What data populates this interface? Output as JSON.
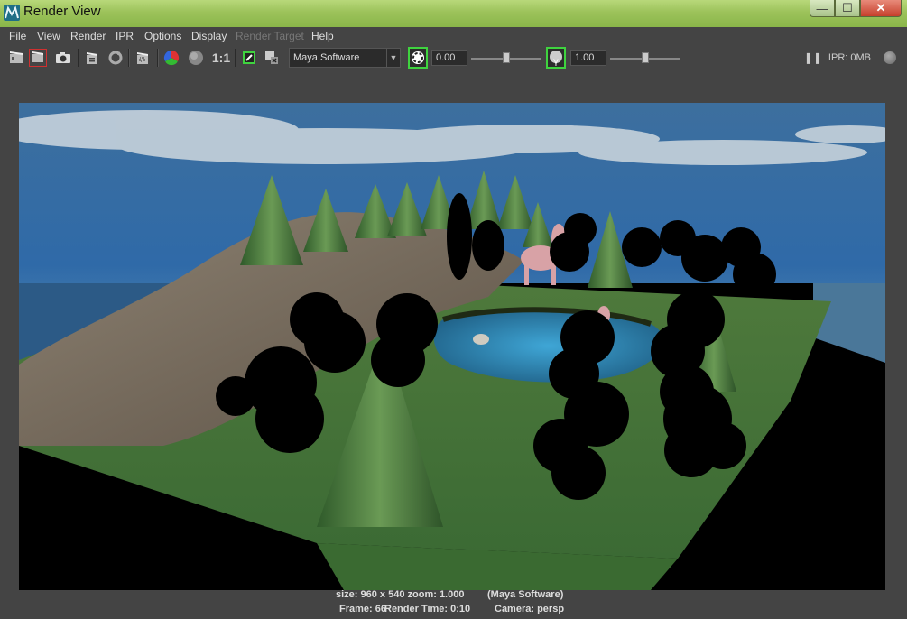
{
  "window": {
    "title": "Render View",
    "controls": {
      "minimize": "—",
      "maximize": "☐",
      "close": "✕"
    }
  },
  "menu": {
    "items": [
      "File",
      "View",
      "Render",
      "IPR",
      "Options",
      "Display",
      "Render Target",
      "Help"
    ],
    "disabled": [
      "Render Target"
    ]
  },
  "toolbar": {
    "renderer_select": "Maya Software",
    "exposure_value": "0.00",
    "exposure_level": 0.5,
    "gamma_value": "1.00",
    "gamma_level": 0.5,
    "ratio_label": "1:1",
    "gamma_badge": "γ",
    "ipr_status": "IPR: 0MB",
    "icons": [
      "render-icon",
      "redo-render-icon",
      "snapshot-icon",
      "ipr-render-icon",
      "refresh-ipr-icon",
      "region-render-icon",
      "rgb-channels-icon",
      "alpha-channel-icon",
      "real-size-icon",
      "keep-image-icon",
      "remove-image-icon",
      "exposure-icon",
      "gamma-icon",
      "pause-ipr-icon",
      "ipr-indicator-icon"
    ]
  },
  "status": {
    "size_zoom": "size: 960 x 540 zoom: 1.000",
    "renderer": "(Maya Software)",
    "frame": "Frame: 66",
    "render_time": "Render Time: 0:10",
    "camera": "Camera: persp"
  },
  "render_image": {
    "description_tags": [
      "sky-clouds",
      "grass-plane",
      "hill",
      "pond",
      "pine-trees",
      "black-placeholder-trees",
      "pink-unicorn",
      "tree-stump"
    ]
  },
  "colors": {
    "titlebar": "#9cc25a",
    "panel": "#444444",
    "accent_green": "#3fd33f",
    "record_red": "#d03030"
  }
}
